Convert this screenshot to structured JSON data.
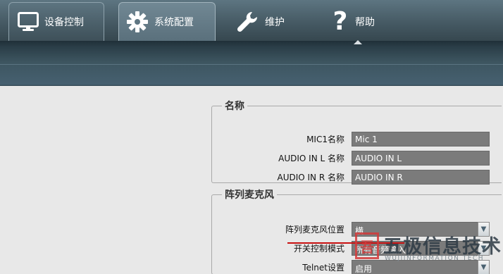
{
  "nav": {
    "tabs": [
      {
        "label": "设备控制",
        "icon": "monitor-icon",
        "active": false
      },
      {
        "label": "系统配置",
        "icon": "gear-icon",
        "active": true
      },
      {
        "label": "维护",
        "icon": "wrench-icon",
        "active": false
      },
      {
        "label": "帮助",
        "icon": "question-icon",
        "active": false
      }
    ]
  },
  "names_group": {
    "title": "名称",
    "rows": [
      {
        "label": "MIC1名称",
        "value": "Mic 1"
      },
      {
        "label": "AUDIO IN L 名称",
        "value": "AUDIO IN L"
      },
      {
        "label": "AUDIO IN R 名称",
        "value": "AUDIO IN R"
      }
    ]
  },
  "array_group": {
    "title": "阵列麦克风",
    "rows": [
      {
        "label": "阵列麦克风位置",
        "value": "横"
      },
      {
        "label": "开关控制模式",
        "value": "所有音频输入"
      },
      {
        "label": "Telnet设置",
        "value": "启用"
      }
    ]
  },
  "watermark": {
    "logo_char": "吾",
    "text": "五极信息技术",
    "sub": "WUJIINFORMATION TECH"
  },
  "colors": {
    "accent_red": "#c81010",
    "nav_bg": "#465a64",
    "field_bg": "#7b7b7b"
  }
}
